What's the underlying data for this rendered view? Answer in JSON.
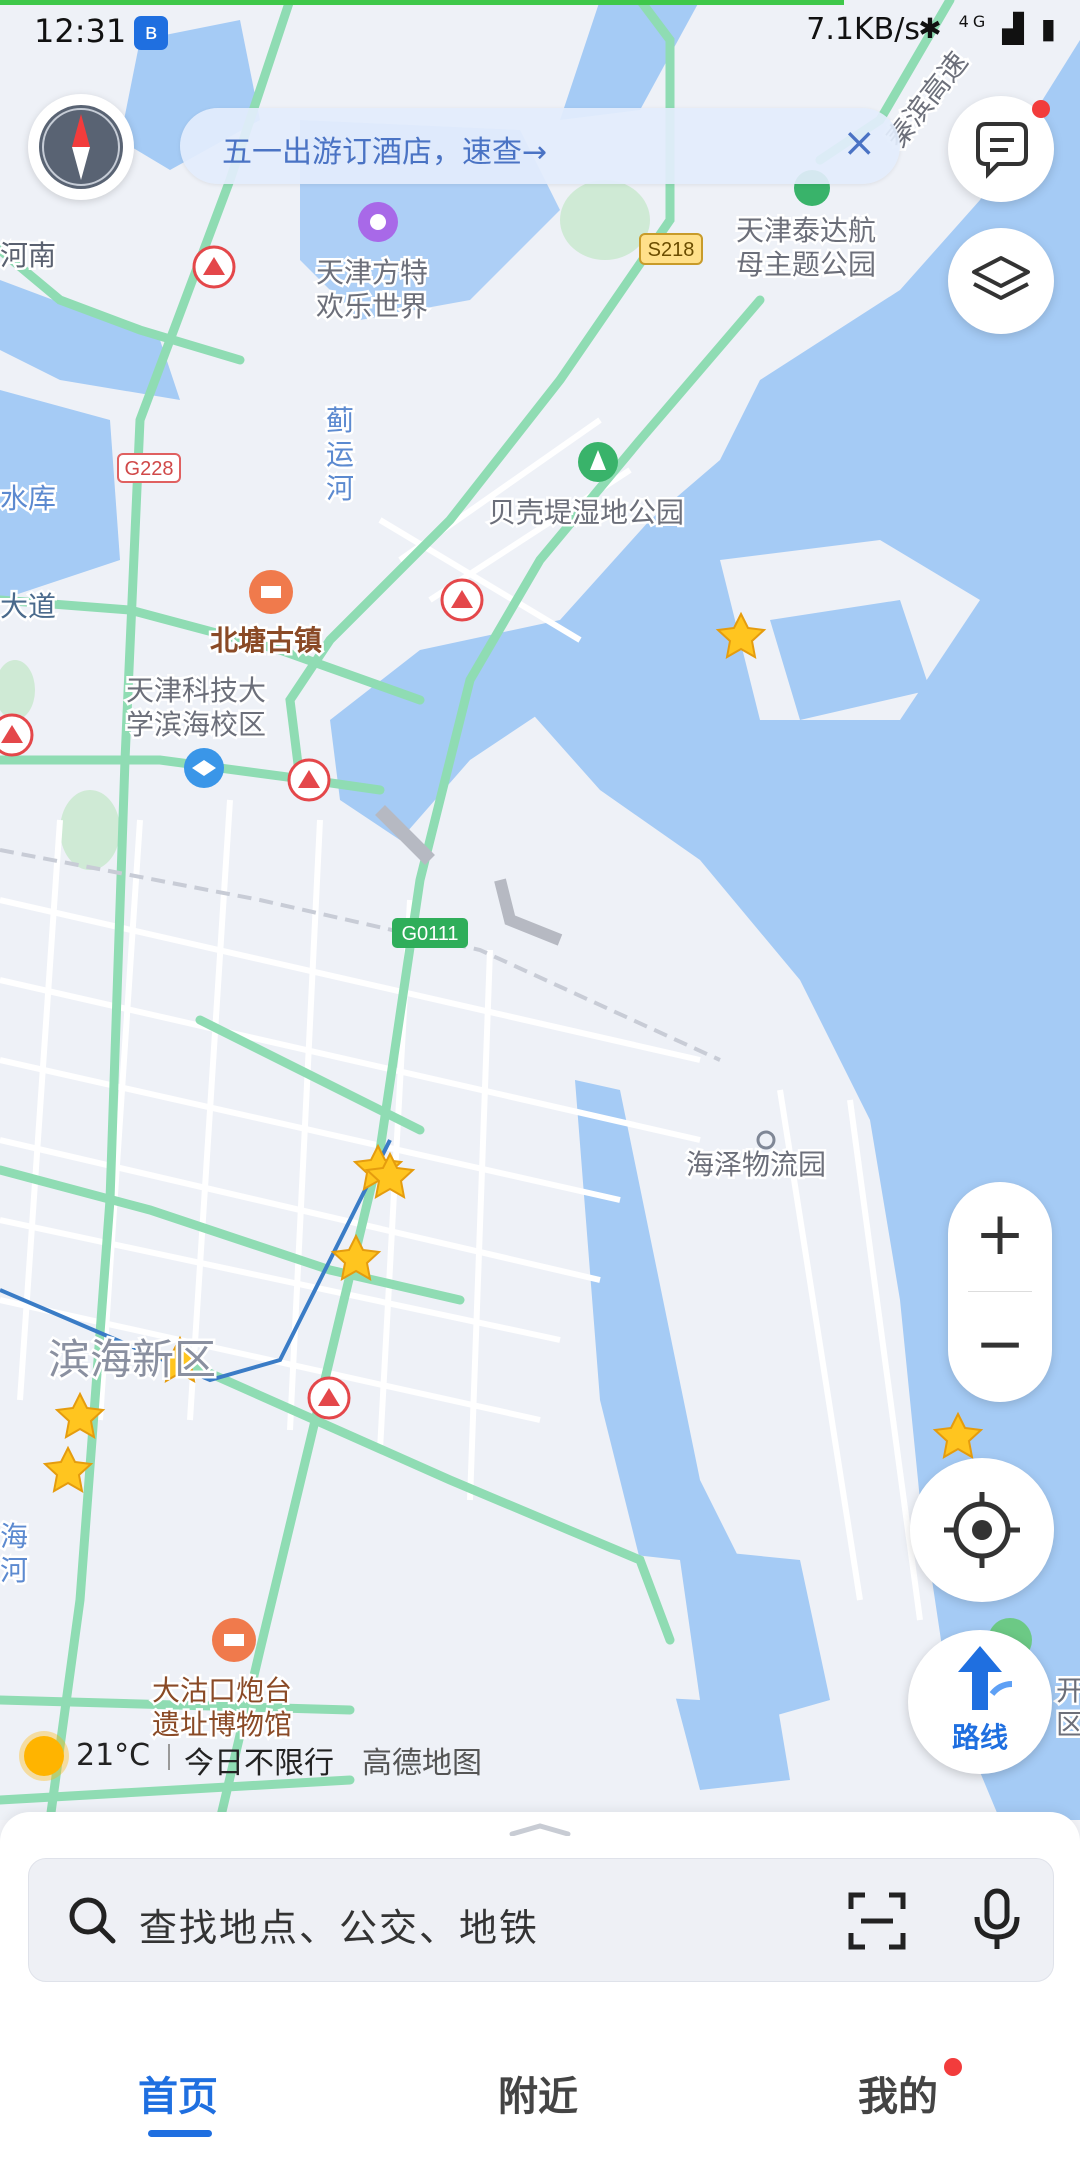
{
  "status_bar": {
    "time": "12:31",
    "bluetooth_badge": "ʙ",
    "net_speed": "7.1KB/s",
    "signal": "4G"
  },
  "banner": {
    "text": "五一出游订酒店，速查→",
    "close": "×"
  },
  "map": {
    "labels": {
      "henan": "河南",
      "fangte1": "天津方特",
      "fangte2": "欢乐世界",
      "taida1": "天津泰达航",
      "taida2": "母主题公园",
      "jiyun1": "蓟",
      "jiyun2": "运",
      "jiyun3": "河",
      "shuiku": "水库",
      "beike": "贝壳堤湿地公园",
      "dadao": "大道",
      "beitang": "北塘古镇",
      "tust1": "天津科技大",
      "tust2": "学滨海校区",
      "haize": "海泽物流园",
      "binhai": "滨海新区",
      "he_left1": "海",
      "he_left2": "河",
      "dagu1": "大沽口炮台",
      "dagu2": "遗址博物馆",
      "kai1": "开",
      "kai2": "区",
      "expressway": "秦滨高速"
    },
    "shields": {
      "s218": "S218",
      "g228": "G228",
      "g0111": "G0111"
    }
  },
  "weather": {
    "temperature": "21°C",
    "restriction": "今日不限行",
    "brand": "高德地图"
  },
  "controls": {
    "zoom_in": "+",
    "zoom_out": "−",
    "route_label": "路线"
  },
  "search": {
    "placeholder": "查找地点、公交、地铁"
  },
  "tabs": [
    {
      "label": "首页",
      "active": true
    },
    {
      "label": "附近",
      "active": false
    },
    {
      "label": "我的",
      "active": false
    }
  ],
  "colors": {
    "accent": "#1f6fe0",
    "water": "#a5cbf5",
    "land": "#eef1f7",
    "road_green": "#8fdcb3"
  }
}
